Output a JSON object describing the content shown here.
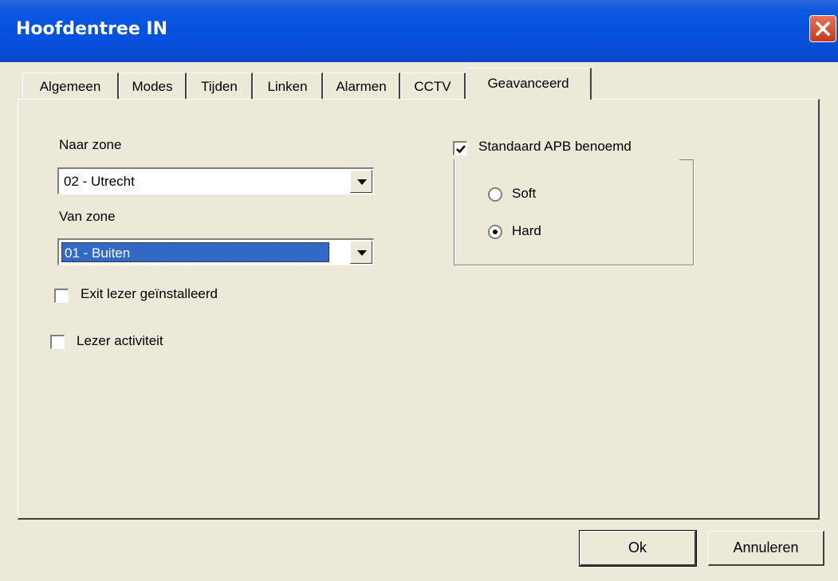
{
  "window": {
    "title": "Hoofdentree IN"
  },
  "tabs": [
    {
      "label": "Algemeen"
    },
    {
      "label": "Modes"
    },
    {
      "label": "Tijden"
    },
    {
      "label": "Linken"
    },
    {
      "label": "Alarmen"
    },
    {
      "label": "CCTV"
    },
    {
      "label": "Geavanceerd",
      "active": true
    }
  ],
  "advanced": {
    "naar_zone": {
      "label": "Naar zone",
      "value": "02 - Utrecht"
    },
    "van_zone": {
      "label": "Van zone",
      "value": "01 - Buiten"
    },
    "exit_reader": {
      "label": "Exit lezer geïnstalleerd",
      "checked": false
    },
    "reader_activity": {
      "label": "Lezer activiteit",
      "checked": false
    },
    "apb": {
      "label": "Standaard APB benoemd",
      "checked": true,
      "options": [
        {
          "label": "Soft",
          "selected": false
        },
        {
          "label": "Hard",
          "selected": true
        }
      ]
    }
  },
  "buttons": {
    "ok": "Ok",
    "cancel": "Annuleren"
  }
}
